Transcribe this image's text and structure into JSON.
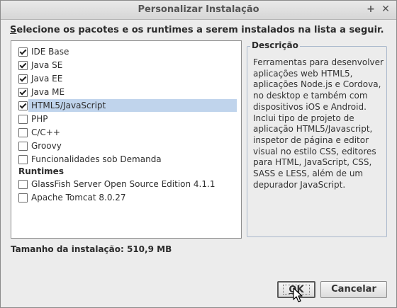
{
  "window": {
    "title": "Personalizar Instalação"
  },
  "titlebar": {
    "maximize_glyph": "+",
    "close_glyph": "✕"
  },
  "instruction": {
    "mnemonic": "S",
    "rest": "elecione os pacotes e os runtimes a serem instalados na lista a seguir."
  },
  "packages": [
    {
      "label": "IDE Base",
      "checked": true,
      "selected": false
    },
    {
      "label": "Java SE",
      "checked": true,
      "selected": false
    },
    {
      "label": "Java EE",
      "checked": true,
      "selected": false
    },
    {
      "label": "Java ME",
      "checked": true,
      "selected": false
    },
    {
      "label": "HTML5/JavaScript",
      "checked": true,
      "selected": true
    },
    {
      "label": "PHP",
      "checked": false,
      "selected": false
    },
    {
      "label": "C/C++",
      "checked": false,
      "selected": false
    },
    {
      "label": "Groovy",
      "checked": false,
      "selected": false
    },
    {
      "label": "Funcionalidades sob Demanda",
      "checked": false,
      "selected": false
    }
  ],
  "runtimes": {
    "heading": "Runtimes",
    "items": [
      {
        "label": "GlassFish Server Open Source Edition 4.1.1",
        "checked": false
      },
      {
        "label": "Apache Tomcat 8.0.27",
        "checked": false
      }
    ]
  },
  "description": {
    "title": "Descrição",
    "text": "Ferramentas para desenvolver aplicações web HTML5, aplicações Node.js e Cordova, no desktop e também com dispositivos iOS e Android. Inclui tipo de projeto de aplicação HTML5/Javascript, inspetor de página e editor visual no estilo CSS, editores para HTML, JavaScript, CSS, SASS e LESS, além de um depurador JavaScript."
  },
  "install_size": {
    "text": "Tamanho da instalação: 510,9 MB"
  },
  "buttons": {
    "ok_mnemonic": "O",
    "ok_rest": "K",
    "cancel": "Cancelar"
  },
  "colors": {
    "selection": "#c0d4ec",
    "panel_border": "#a9b8cc"
  }
}
